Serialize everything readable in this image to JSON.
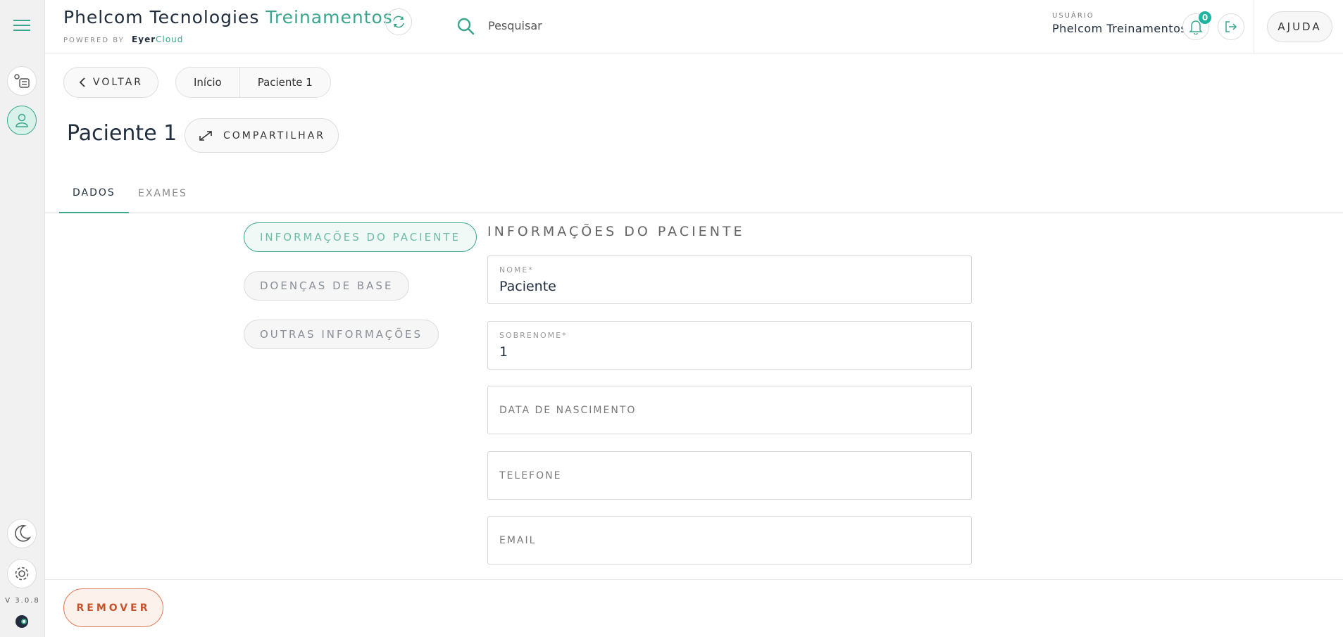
{
  "header": {
    "brand_main": "Phelcom Tecnologies",
    "brand_accent": "Treinamentos",
    "powered_by": "POWERED BY",
    "powered_brand_a": "Eyer",
    "powered_brand_b": "Cloud",
    "search_placeholder": "Pesquisar",
    "user_caption": "USUÁRIO",
    "user_name": "Phelcom Treinamentos",
    "notification_count": "0",
    "help_label": "AJUDA"
  },
  "sidebar": {
    "version": "V 3.0.8"
  },
  "nav": {
    "back_label": "VOLTAR",
    "breadcrumb": [
      "Início",
      "Paciente 1"
    ]
  },
  "page": {
    "title": "Paciente 1",
    "share_label": "COMPARTILHAR"
  },
  "tabs": [
    {
      "label": "DADOS",
      "active": true
    },
    {
      "label": "EXAMES",
      "active": false
    }
  ],
  "sections": [
    {
      "label": "INFORMAÇÕES DO PACIENTE",
      "active": true
    },
    {
      "label": "DOENÇAS DE BASE",
      "active": false
    },
    {
      "label": "OUTRAS INFORMAÇÕES",
      "active": false
    }
  ],
  "form": {
    "heading": "INFORMAÇÕES DO PACIENTE",
    "fields": [
      {
        "label": "NOME*",
        "value": "Paciente"
      },
      {
        "label": "SOBRENOME*",
        "value": "1"
      },
      {
        "label": "DATA DE NASCIMENTO",
        "value": ""
      },
      {
        "label": "TELEFONE",
        "value": ""
      },
      {
        "label": "EMAIL",
        "value": ""
      }
    ]
  },
  "footer": {
    "remove_label": "REMOVER"
  },
  "colors": {
    "accent": "#3aa68d",
    "danger": "#c8522a",
    "badge": "#1fb5a0"
  }
}
